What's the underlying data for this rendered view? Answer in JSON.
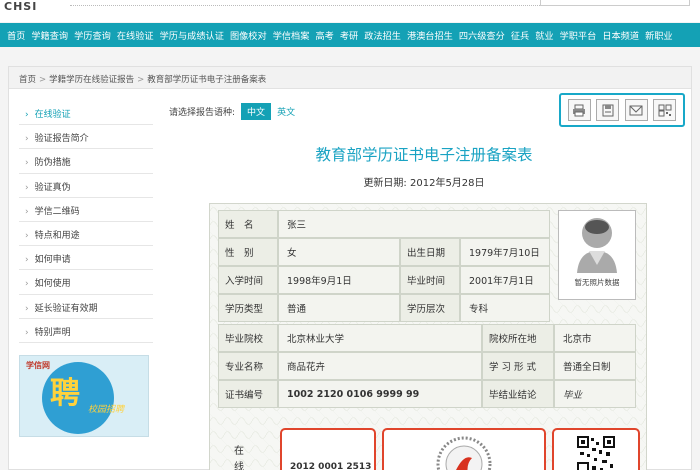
{
  "header": {
    "logo_text": "CHSI"
  },
  "nav": {
    "items": [
      "首页",
      "学籍查询",
      "学历查询",
      "在线验证",
      "学历与成绩认证",
      "图像校对",
      "学信档案",
      "高考",
      "考研",
      "政法招生",
      "港澳台招生",
      "四六级查分",
      "征兵",
      "就业",
      "学职平台",
      "日本频道",
      "新职业"
    ]
  },
  "breadcrumb": {
    "items": [
      "首页",
      "学籍学历在线验证报告",
      "教育部学历证书电子注册备案表"
    ],
    "separator": ">"
  },
  "sidebar": {
    "items": [
      {
        "label": "在线验证",
        "active": true
      },
      {
        "label": "验证报告简介",
        "active": false
      },
      {
        "label": "防伪措施",
        "active": false
      },
      {
        "label": "验证真伪",
        "active": false
      },
      {
        "label": "学信二维码",
        "active": false
      },
      {
        "label": "特点和用途",
        "active": false
      },
      {
        "label": "如何申请",
        "active": false
      },
      {
        "label": "如何使用",
        "active": false
      },
      {
        "label": "延长验证有效期",
        "active": false
      },
      {
        "label": "特别声明",
        "active": false
      }
    ],
    "arrow": "›"
  },
  "promo": {
    "brand": "学信网",
    "big_char": "聘",
    "tagline": "校园招聘"
  },
  "language": {
    "prompt": "请选择报告语种:",
    "options": [
      "中文",
      "英文"
    ],
    "selected": "中文"
  },
  "toolbox": {
    "icons": [
      "print-icon",
      "save-icon",
      "mail-icon",
      "qrcode-icon"
    ]
  },
  "document": {
    "title": "教育部学历证书电子注册备案表",
    "update_label": "更新日期:",
    "update_date": "2012年5月28日"
  },
  "record": {
    "fields": {
      "name_label": "姓　名",
      "name_value": "张三",
      "gender_label": "性　别",
      "gender_value": "女",
      "birth_label": "出生日期",
      "birth_value": "1979年7月10日",
      "enroll_label": "入学时间",
      "enroll_value": "1998年9月1日",
      "grad_label": "毕业时间",
      "grad_value": "2001年7月1日",
      "type_label": "学历类型",
      "type_value": "普通",
      "level_label": "学历层次",
      "level_value": "专科",
      "school_label": "毕业院校",
      "school_value": "北京林业大学",
      "loc_label": "院校所在地",
      "loc_value": "北京市",
      "major_label": "专业名称",
      "major_value": "商品花卉",
      "form_label": "学 习 形 式",
      "form_value": "普通全日制",
      "cert_label": "证书编号",
      "cert_value": "1002 2120 0106 9999 99",
      "conclusion_label": "毕结业结论",
      "conclusion_value": "毕业"
    },
    "photo_caption": "暂无照片数据",
    "qr_section_label": "在线",
    "qr_code_text": "2012 0001 2513"
  },
  "colors": {
    "nav_bg": "#14a1b5",
    "accent": "#1aa3c3",
    "highlight_box": "#e0452c"
  }
}
